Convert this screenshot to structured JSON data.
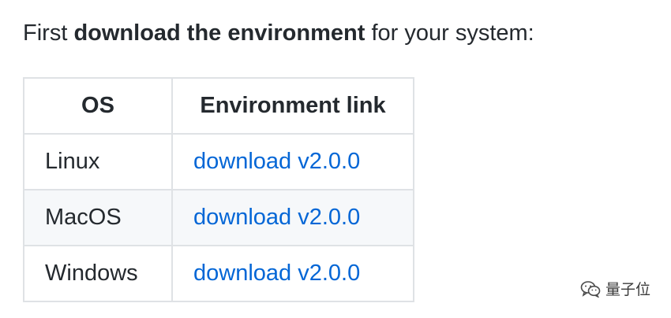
{
  "intro": {
    "prefix": "First ",
    "bold": "download the environment",
    "suffix": " for your system:"
  },
  "table": {
    "headers": [
      "OS",
      "Environment link"
    ],
    "rows": [
      {
        "os": "Linux",
        "link": "download v2.0.0"
      },
      {
        "os": "MacOS",
        "link": "download v2.0.0"
      },
      {
        "os": "Windows",
        "link": "download v2.0.0"
      }
    ]
  },
  "watermark": {
    "icon": "wechat-icon",
    "text": "量子位"
  },
  "colors": {
    "link": "#0366d6",
    "border": "#dfe2e5",
    "alt_row": "#f6f8fa",
    "text": "#24292e"
  }
}
